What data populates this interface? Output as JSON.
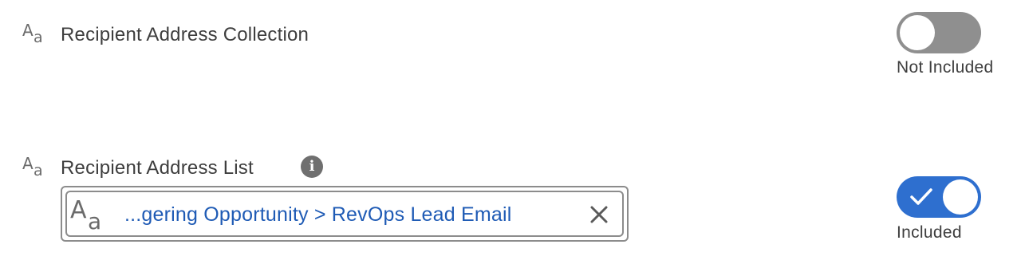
{
  "fields": [
    {
      "label": "Recipient Address Collection",
      "type_icon": "text-type-icon",
      "toggle": {
        "state": "off",
        "label": "Not Included"
      }
    },
    {
      "label": "Recipient Address List",
      "type_icon": "text-type-icon",
      "info_icon": "i",
      "value_pill": {
        "text": "...gering Opportunity > RevOps Lead Email",
        "remove_icon": "close-icon"
      },
      "toggle": {
        "state": "on",
        "label": "Included"
      }
    }
  ],
  "colors": {
    "toggle_on": "#2e6fcf",
    "toggle_off": "#8f8f8f",
    "pill_text": "#1f5bb5"
  }
}
